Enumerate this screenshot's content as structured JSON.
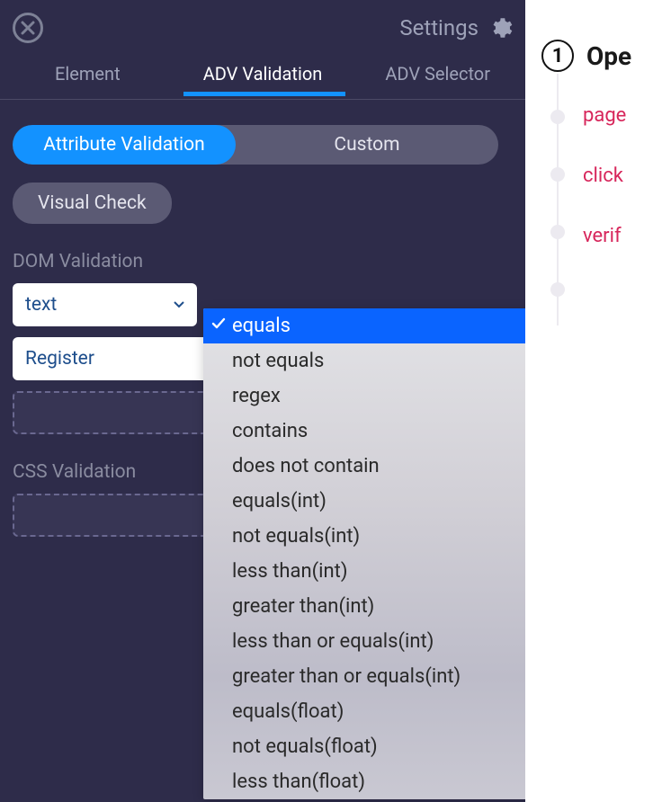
{
  "header": {
    "settings_label": "Settings"
  },
  "tabs": [
    "Element",
    "ADV Validation",
    "ADV Selector"
  ],
  "active_tab": "ADV Validation",
  "validation_modes": {
    "attribute": "Attribute Validation",
    "custom": "Custom",
    "visual": "Visual Check"
  },
  "sections": {
    "dom": "DOM Validation",
    "css": "CSS Validation"
  },
  "dom": {
    "attribute_select": "text",
    "value_input": "Register"
  },
  "operator_dropdown": {
    "selected": "equals",
    "options": [
      "equals",
      "not equals",
      "regex",
      "contains",
      "does not contain",
      "equals(int)",
      "not equals(int)",
      "less than(int)",
      "greater than(int)",
      "less than or equals(int)",
      "greater than or equals(int)",
      "equals(float)",
      "not equals(float)",
      "less than(float)"
    ]
  },
  "right": {
    "step_number": "1",
    "step_title": "Ope",
    "sub_items": [
      "page",
      "click",
      "verif"
    ]
  },
  "colors": {
    "panel_bg": "#2e2c4a",
    "accent_blue": "#1392ff",
    "pill_bg": "#5b5a74",
    "muted_text": "#9ea2b8",
    "dropdown_highlight": "#0a64ff",
    "link_red": "#d7265b"
  }
}
